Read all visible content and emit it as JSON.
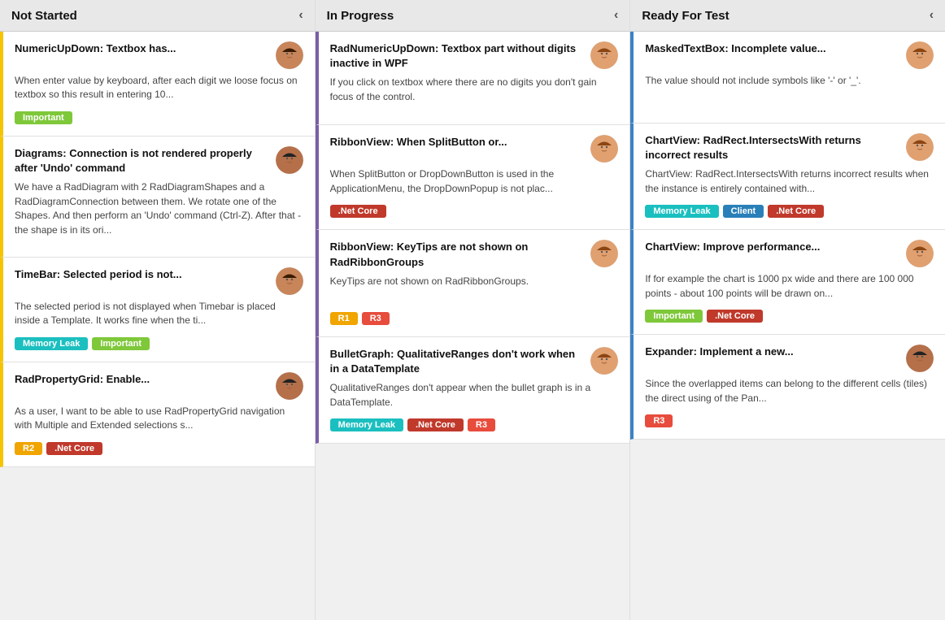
{
  "columns": [
    {
      "id": "not-started",
      "title": "Not Started",
      "accent": "accent-yellow",
      "cards": [
        {
          "title": "NumericUpDown: Textbox has...",
          "description": "When enter value by keyboard, after each digit we loose focus on textbox so this result in entering 10...",
          "tags": [
            {
              "label": "Important",
              "class": "tag-important"
            }
          ],
          "avatar": "f1"
        },
        {
          "title": "Diagrams: Connection is not rendered properly after 'Undo' command",
          "description": "We have a RadDiagram with 2 RadDiagramShapes and a RadDiagramConnection between them. We rotate one of the Shapes. And then perform an 'Undo' command (Ctrl-Z). After that - the shape is in its ori...",
          "tags": [],
          "avatar": "f2"
        },
        {
          "title": "TimeBar: Selected period is not...",
          "description": "The selected period is not displayed when Timebar is placed inside a Template. It works fine when the ti...",
          "tags": [
            {
              "label": "Memory Leak",
              "class": "tag-memory-leak"
            },
            {
              "label": "Important",
              "class": "tag-important"
            }
          ],
          "avatar": "f1"
        },
        {
          "title": "RadPropertyGrid: Enable...",
          "description": "As a user, I want to be able to use RadPropertyGrid navigation with Multiple and Extended selections s...",
          "tags": [
            {
              "label": "R2",
              "class": "tag-r2"
            },
            {
              "label": ".Net Core",
              "class": "tag-net-core"
            }
          ],
          "avatar": "f2"
        }
      ]
    },
    {
      "id": "in-progress",
      "title": "In Progress",
      "accent": "accent-purple",
      "cards": [
        {
          "title": "RadNumericUpDown: Textbox part without digits inactive in WPF",
          "description": "If you click on textbox where there are no digits you don't gain focus of the control.",
          "tags": [],
          "avatar": "f3"
        },
        {
          "title": "RibbonView: When SplitButton or...",
          "description": "When SplitButton or DropDownButton is used in the ApplicationMenu, the DropDownPopup is not plac...",
          "tags": [
            {
              "label": ".Net Core",
              "class": "tag-net-core"
            }
          ],
          "avatar": "f3"
        },
        {
          "title": "RibbonView: KeyTips are not shown on RadRibbonGroups",
          "description": "KeyTips are not shown on RadRibbonGroups.",
          "tags": [
            {
              "label": "R1",
              "class": "tag-r1"
            },
            {
              "label": "R3",
              "class": "tag-r3"
            }
          ],
          "avatar": "f3"
        },
        {
          "title": "BulletGraph: QualitativeRanges don't work when in a DataTemplate",
          "description": "QualitativeRanges don't appear when the bullet graph is in a DataTemplate.",
          "tags": [
            {
              "label": "Memory Leak",
              "class": "tag-memory-leak"
            },
            {
              "label": ".Net Core",
              "class": "tag-net-core"
            },
            {
              "label": "R3",
              "class": "tag-r3"
            }
          ],
          "avatar": "f3"
        }
      ]
    },
    {
      "id": "ready-for-test",
      "title": "Ready For Test",
      "accent": "accent-blue",
      "cards": [
        {
          "title": "MaskedTextBox: Incomplete value...",
          "description": "The value should not include symbols like '-' or '_'.",
          "tags": [],
          "avatar": "f3"
        },
        {
          "title": "ChartView: RadRect.IntersectsWith returns incorrect results",
          "description": "ChartView: RadRect.IntersectsWith returns incorrect results when the instance is entirely contained with...",
          "tags": [
            {
              "label": "Memory Leak",
              "class": "tag-memory-leak"
            },
            {
              "label": "Client",
              "class": "tag-client"
            },
            {
              "label": ".Net Core",
              "class": "tag-net-core"
            }
          ],
          "avatar": "f3"
        },
        {
          "title": "ChartView: Improve performance...",
          "description": "If for example the chart is 1000 px wide and there are 100 000 points - about 100 points will be drawn on...",
          "tags": [
            {
              "label": "Important",
              "class": "tag-important"
            },
            {
              "label": ".Net Core",
              "class": "tag-net-core"
            }
          ],
          "avatar": "f3"
        },
        {
          "title": "Expander: Implement a new...",
          "description": "Since the overlapped items can belong to the different cells (tiles) the direct using of the Pan...",
          "tags": [
            {
              "label": "R3",
              "class": "tag-r3"
            }
          ],
          "avatar": "f2"
        }
      ]
    }
  ],
  "icons": {
    "chevron_left": "‹"
  }
}
